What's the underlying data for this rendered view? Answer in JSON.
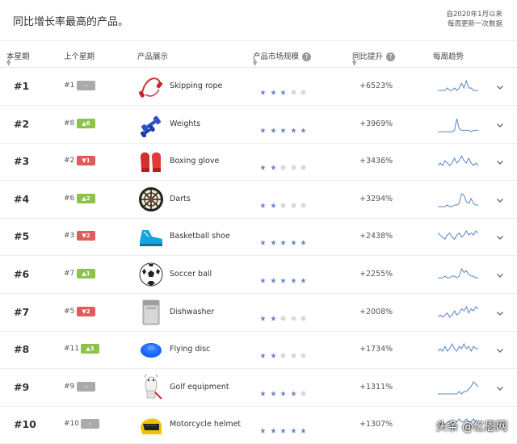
{
  "header": {
    "title": "同比增长率最高的产品。",
    "date_line1": "自2020年1月以来",
    "date_line2": "每周更新一次数据"
  },
  "columns": {
    "this_week": "本星期",
    "last_week": "上个星期",
    "product": "产品展示",
    "market_size": "产品市场规模",
    "yoy_lift": "同比提升",
    "weekly_trend": "每周趋势",
    "help_glyph": "?"
  },
  "colors": {
    "star_on": "#6b84c4",
    "star_off": "#d9d9d9",
    "up": "#8cc34b",
    "down": "#e05b5b",
    "same": "#aaaaaa",
    "spark": "#5a86c8"
  },
  "rows": [
    {
      "rank": "#1",
      "prev": "#1",
      "change": "-",
      "dir": "same",
      "icon": "skipping-rope-icon",
      "name": "Skipping rope",
      "market": 3,
      "lift": "+6523%",
      "trend": [
        2,
        2,
        2,
        2,
        3,
        2,
        2,
        3,
        2,
        3,
        5,
        3,
        6,
        3,
        3,
        2,
        2,
        2
      ]
    },
    {
      "rank": "#2",
      "prev": "#8",
      "change": "▲6",
      "dir": "up",
      "icon": "weights-icon",
      "name": "Weights",
      "market": 5,
      "lift": "+3969%",
      "trend": [
        1,
        1,
        1,
        1,
        1,
        1,
        1,
        2,
        10,
        3,
        2,
        2,
        2,
        2,
        1,
        2,
        2,
        2
      ]
    },
    {
      "rank": "#3",
      "prev": "#2",
      "change": "▼1",
      "dir": "down",
      "icon": "boxing-glove-icon",
      "name": "Boxing glove",
      "market": 2,
      "lift": "+3436%",
      "trend": [
        2,
        3,
        2,
        4,
        3,
        2,
        3,
        5,
        3,
        4,
        6,
        4,
        3,
        5,
        3,
        2,
        3,
        2
      ]
    },
    {
      "rank": "#4",
      "prev": "#6",
      "change": "▲2",
      "dir": "up",
      "icon": "darts-icon",
      "name": "Darts",
      "market": 2,
      "lift": "+3294%",
      "trend": [
        1,
        1,
        1,
        1,
        2,
        1,
        1,
        2,
        2,
        3,
        9,
        8,
        4,
        3,
        6,
        3,
        2,
        2
      ]
    },
    {
      "rank": "#5",
      "prev": "#3",
      "change": "▼2",
      "dir": "down",
      "icon": "basketball-shoe-icon",
      "name": "Basketball shoe",
      "market": 5,
      "lift": "+2438%",
      "trend": [
        6,
        5,
        4,
        3,
        5,
        6,
        4,
        3,
        5,
        6,
        4,
        5,
        7,
        5,
        6,
        5,
        7,
        6
      ]
    },
    {
      "rank": "#6",
      "prev": "#7",
      "change": "▲1",
      "dir": "up",
      "icon": "soccer-ball-icon",
      "name": "Soccer ball",
      "market": 5,
      "lift": "+2255%",
      "trend": [
        3,
        3,
        3,
        4,
        3,
        3,
        4,
        4,
        3,
        4,
        8,
        6,
        7,
        5,
        4,
        4,
        3,
        3
      ]
    },
    {
      "rank": "#7",
      "prev": "#5",
      "change": "▼2",
      "dir": "down",
      "icon": "dishwasher-icon",
      "name": "Dishwasher",
      "market": 2,
      "lift": "+2008%",
      "trend": [
        2,
        3,
        2,
        3,
        4,
        2,
        3,
        5,
        3,
        4,
        6,
        5,
        7,
        4,
        6,
        5,
        7,
        6
      ]
    },
    {
      "rank": "#8",
      "prev": "#11",
      "change": "▲3",
      "dir": "up",
      "icon": "flying-disc-icon",
      "name": "Flying disc",
      "market": 2,
      "lift": "+1734%",
      "trend": [
        3,
        4,
        3,
        5,
        3,
        4,
        6,
        4,
        3,
        5,
        4,
        6,
        4,
        5,
        3,
        5,
        4,
        4
      ]
    },
    {
      "rank": "#9",
      "prev": "#9",
      "change": "-",
      "dir": "same",
      "icon": "golf-equipment-icon",
      "name": "Golf equipment",
      "market": 4,
      "lift": "+1311%",
      "trend": [
        1,
        1,
        1,
        1,
        1,
        1,
        1,
        1,
        1,
        2,
        1,
        2,
        2,
        3,
        4,
        6,
        5,
        4
      ]
    },
    {
      "rank": "#10",
      "prev": "#10",
      "change": "-",
      "dir": "same",
      "icon": "motorcycle-helmet-icon",
      "name": "Motorcycle helmet",
      "market": 5,
      "lift": "+1307%",
      "trend": [
        3,
        3,
        4,
        3,
        4,
        4,
        3,
        4,
        4,
        5,
        4,
        4,
        5,
        4,
        4,
        5,
        4,
        4
      ]
    }
  ],
  "watermark": "头条 @亿恩网"
}
